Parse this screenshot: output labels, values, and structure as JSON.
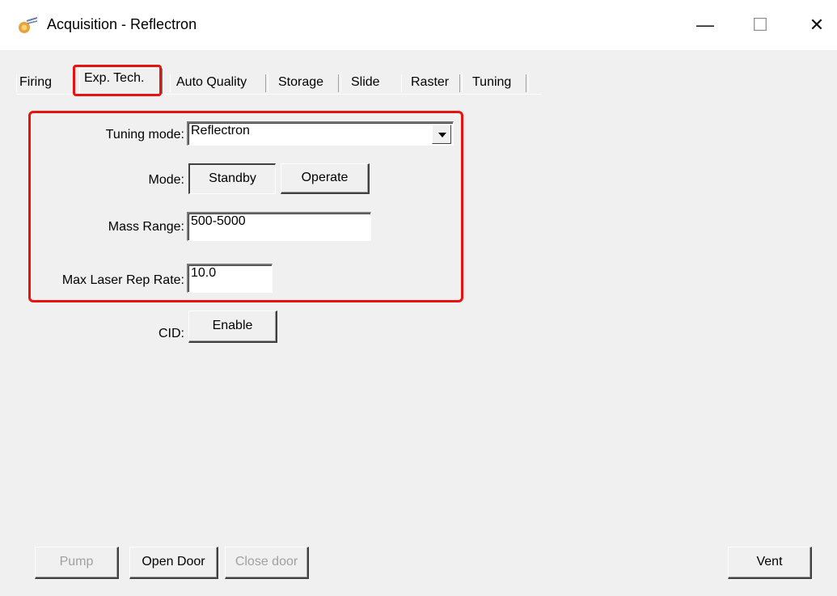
{
  "window": {
    "title": "Acquisition - Reflectron",
    "app_icon": "reflectron-app-icon",
    "controls": {
      "minimize_glyph": "—",
      "maximize_glyph": "☐",
      "close_glyph": "✕"
    }
  },
  "tabs": [
    {
      "label": "Firing",
      "active": false
    },
    {
      "label": "Exp. Tech.",
      "active": true
    },
    {
      "label": "Auto Quality",
      "active": false
    },
    {
      "label": "Storage",
      "active": false
    },
    {
      "label": "Slide",
      "active": false
    },
    {
      "label": "Raster",
      "active": false
    },
    {
      "label": "Tuning",
      "active": false
    }
  ],
  "form": {
    "tuning_mode": {
      "label": "Tuning mode:",
      "value": "Reflectron"
    },
    "mode": {
      "label": "Mode:",
      "standby": "Standby",
      "operate": "Operate",
      "selected": "Standby"
    },
    "mass_range": {
      "label": "Mass Range:",
      "value": "500-5000"
    },
    "max_laser_rep_rate": {
      "label": "Max Laser Rep Rate:",
      "value": "10.0"
    },
    "cid": {
      "label": "CID:",
      "button": "Enable"
    }
  },
  "bottom_buttons": {
    "pump": {
      "label": "Pump",
      "enabled": false
    },
    "open_door": {
      "label": "Open Door",
      "enabled": true
    },
    "close_door": {
      "label": "Close door",
      "enabled": false
    },
    "vent": {
      "label": "Vent",
      "enabled": true
    }
  },
  "colors": {
    "highlight": "#e8130f",
    "dialog_bg": "#f0f0f0"
  }
}
